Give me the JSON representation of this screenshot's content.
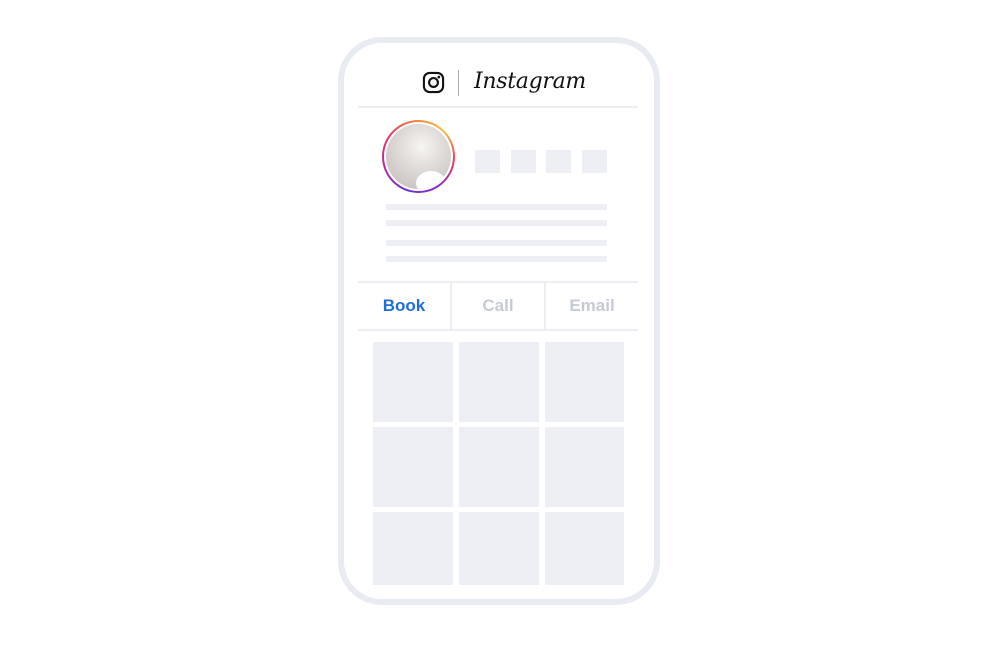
{
  "header": {
    "brand": "Instagram",
    "icon": "instagram-icon"
  },
  "profile": {
    "avatar": "profile-avatar",
    "stats_placeholder_count": 4,
    "bio_placeholder_lines": 4
  },
  "actions": [
    {
      "label": "Book",
      "active": true
    },
    {
      "label": "Call",
      "active": false
    },
    {
      "label": "Email",
      "active": false
    }
  ],
  "grid": {
    "rows": 3,
    "columns": 3
  },
  "colors": {
    "accent": "#1f6ed4",
    "inactive_text": "#c6cad5",
    "placeholder": "#eeeff4",
    "frame": "#e8ebf1"
  }
}
